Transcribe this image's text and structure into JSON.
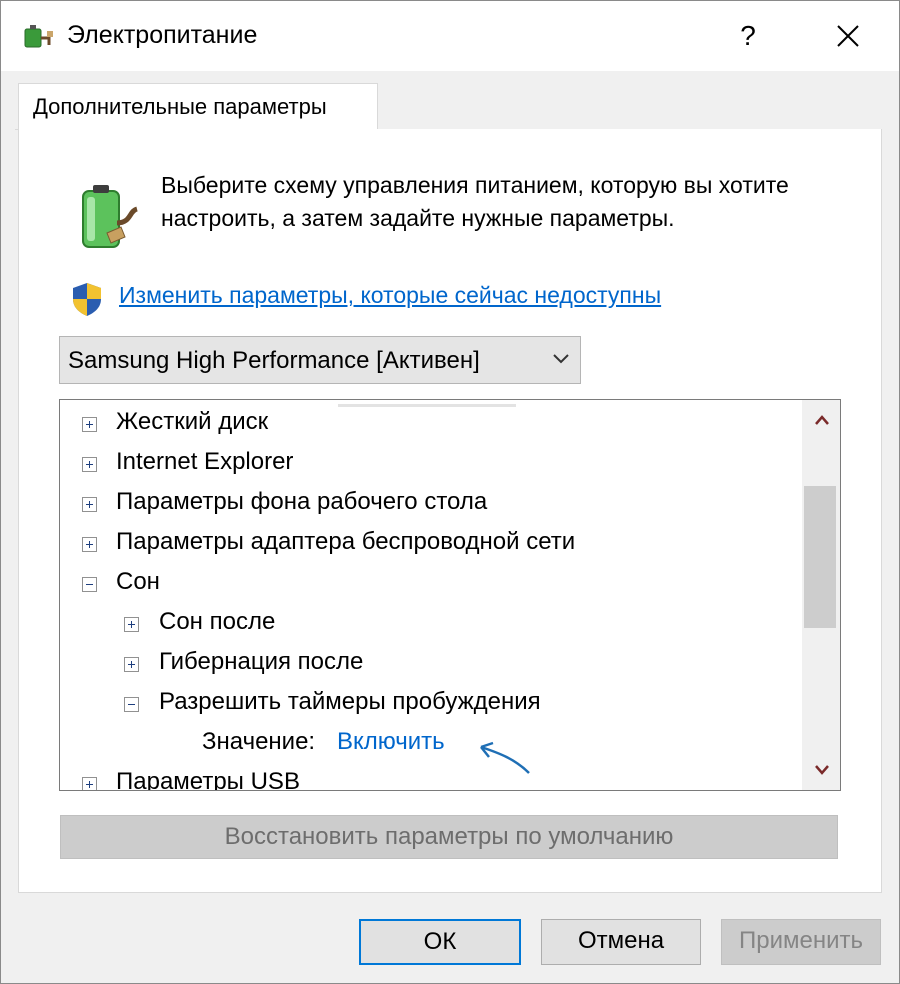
{
  "window": {
    "title": "Электропитание",
    "help_glyph": "?"
  },
  "tab": {
    "label": "Дополнительные параметры"
  },
  "intro_text": "Выберите схему управления питанием, которую вы хотите настроить, а затем задайте нужные параметры.",
  "admin_link": "Изменить параметры, которые сейчас недоступны",
  "plan_select": {
    "selected": "Samsung High Performance [Активен]"
  },
  "tree": {
    "items": [
      {
        "label": "Жесткий диск",
        "expanded": false,
        "level": 0
      },
      {
        "label": "Internet Explorer",
        "expanded": false,
        "level": 0
      },
      {
        "label": "Параметры фона рабочего стола",
        "expanded": false,
        "level": 0
      },
      {
        "label": "Параметры адаптера беспроводной сети",
        "expanded": false,
        "level": 0
      },
      {
        "label": "Сон",
        "expanded": true,
        "level": 0
      },
      {
        "label": "Сон после",
        "expanded": false,
        "level": 1
      },
      {
        "label": "Гибернация после",
        "expanded": false,
        "level": 1
      },
      {
        "label": "Разрешить таймеры пробуждения",
        "expanded": true,
        "level": 1
      },
      {
        "label": "Параметры USB",
        "expanded": false,
        "level": 0
      }
    ],
    "value_label": "Значение:",
    "value": "Включить"
  },
  "buttons": {
    "restore": "Восстановить параметры по умолчанию",
    "ok": "ОК",
    "cancel": "Отмена",
    "apply": "Применить"
  },
  "colors": {
    "link": "#0066cc",
    "ok_border": "#0078d7",
    "annotation_arrow": "#1f6fb5"
  },
  "icons": {
    "app": "power-plug-icon",
    "battery": "battery-plug-icon",
    "shield": "uac-shield-icon"
  }
}
